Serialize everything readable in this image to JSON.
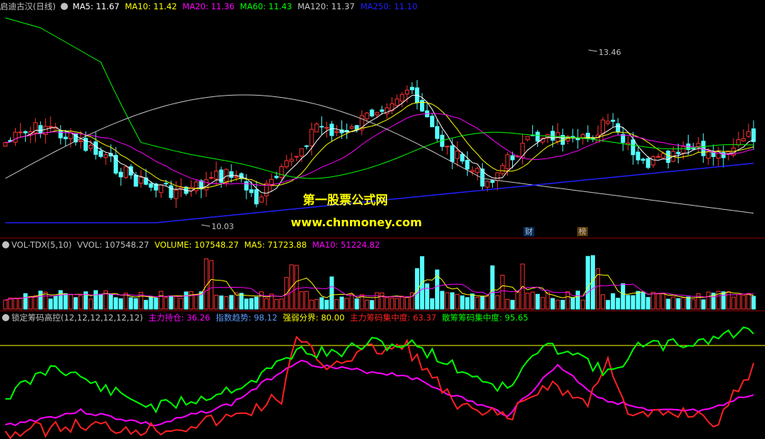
{
  "price_header": {
    "title": "启迪古汉(日线)",
    "ma5": "MA5: 11.67",
    "ma10": "MA10: 11.42",
    "ma20": "MA20: 11.36",
    "ma60": "MA60: 11.43",
    "ma120": "MA120: 11.37",
    "ma250": "MA250: 11.10"
  },
  "price_annotations": {
    "high_label": "13.46",
    "low_label": "10.03",
    "tag_cai": "财",
    "tag_bang": "榜"
  },
  "watermark": {
    "site_name": "第一股票公式网",
    "url": "www.chnmoney.com"
  },
  "volume_header": {
    "title": "VOL-TDX(5,10)",
    "vvol": "VVOL: 107548.27",
    "volume": "VOLUME: 107548.27",
    "ma5": "MA5: 71723.88",
    "ma10": "MA10: 51224.82"
  },
  "indicator_header": {
    "title": "锁定筹码高控(12,12,12,12,12,12)",
    "zlcc": "主力持仓: 36.26",
    "zsqs": "指数趋势: 98.12",
    "qrfj": "强弱分界: 80.00",
    "zljz": "主力筹码集中度: 63.37",
    "shjz": "散筹筹码集中度: 95.65"
  },
  "colors": {
    "up": "#ff3232",
    "down": "#54ffff",
    "ma5": "#ffffff",
    "ma10": "#ffff00",
    "ma20": "#ff00ff",
    "ma60": "#00ff00",
    "ma120": "#c8c8c8",
    "ma250": "#2020ff",
    "indicator_green": "#00ff00",
    "indicator_red": "#ff2020",
    "indicator_magenta": "#ff00ff",
    "indicator_threshold": "#ffff00"
  }
}
